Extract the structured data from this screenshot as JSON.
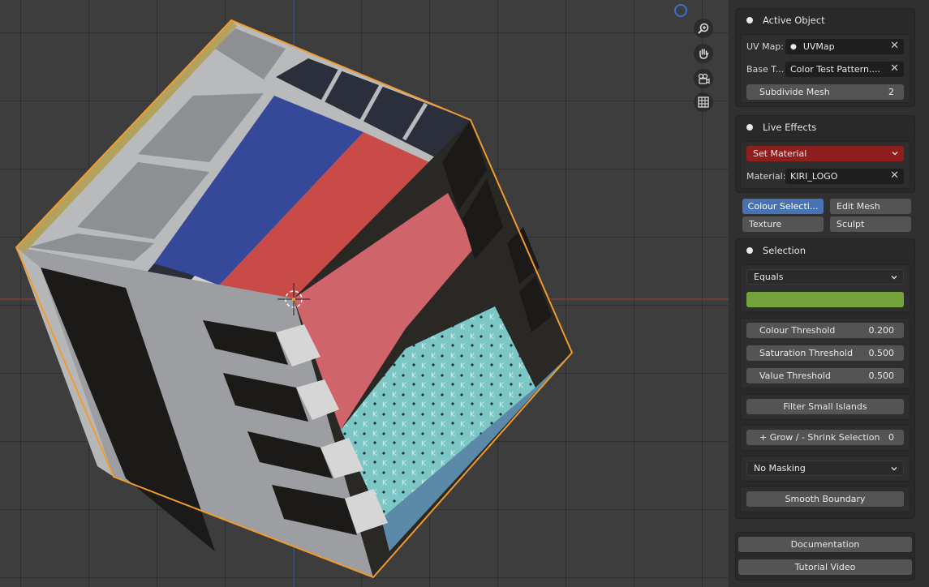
{
  "active_object": {
    "title": "Active Object",
    "uv_map_label": "UV Map:",
    "uv_map_value": "UVMap",
    "base_label": "Base T...",
    "base_value": "Color Test Pattern....",
    "subdivide_label": "Subdivide Mesh",
    "subdivide_value": "2"
  },
  "live_effects": {
    "title": "Live Effects",
    "effect_select": "Set Material",
    "material_label": "Material:",
    "material_value": "KIRI_LOGO"
  },
  "mode_tabs": [
    {
      "label": "Colour Selecti...",
      "active": true
    },
    {
      "label": "Edit Mesh",
      "active": false
    },
    {
      "label": "Texture",
      "active": false
    },
    {
      "label": "Sculpt",
      "active": false
    }
  ],
  "selection": {
    "title": "Selection",
    "compare_mode": "Equals",
    "picked_colour": "#74a23c",
    "colour_threshold_label": "Colour Threshold",
    "colour_threshold_value": "0.200",
    "saturation_threshold_label": "Saturation Threshold",
    "saturation_threshold_value": "0.500",
    "value_threshold_label": "Value Threshold",
    "value_threshold_value": "0.500",
    "filter_islands_label": "Filter Small Islands",
    "grow_shrink_label": "+ Grow / - Shrink Selection",
    "grow_shrink_value": "0",
    "masking_select": "No Masking",
    "smooth_boundary_label": "Smooth Boundary"
  },
  "help": {
    "documentation_label": "Documentation",
    "tutorial_label": "Tutorial Video"
  },
  "viewport_tools": [
    "zoom-icon",
    "pan-hand-icon",
    "camera-icon",
    "grid-icon"
  ],
  "colors": {
    "accent": "#4772b3",
    "set_material_red": "#8f1e1e",
    "selection_outline": "#f29a2e",
    "axis_x": "#a63a3a",
    "axis_y": "#3660a6"
  }
}
